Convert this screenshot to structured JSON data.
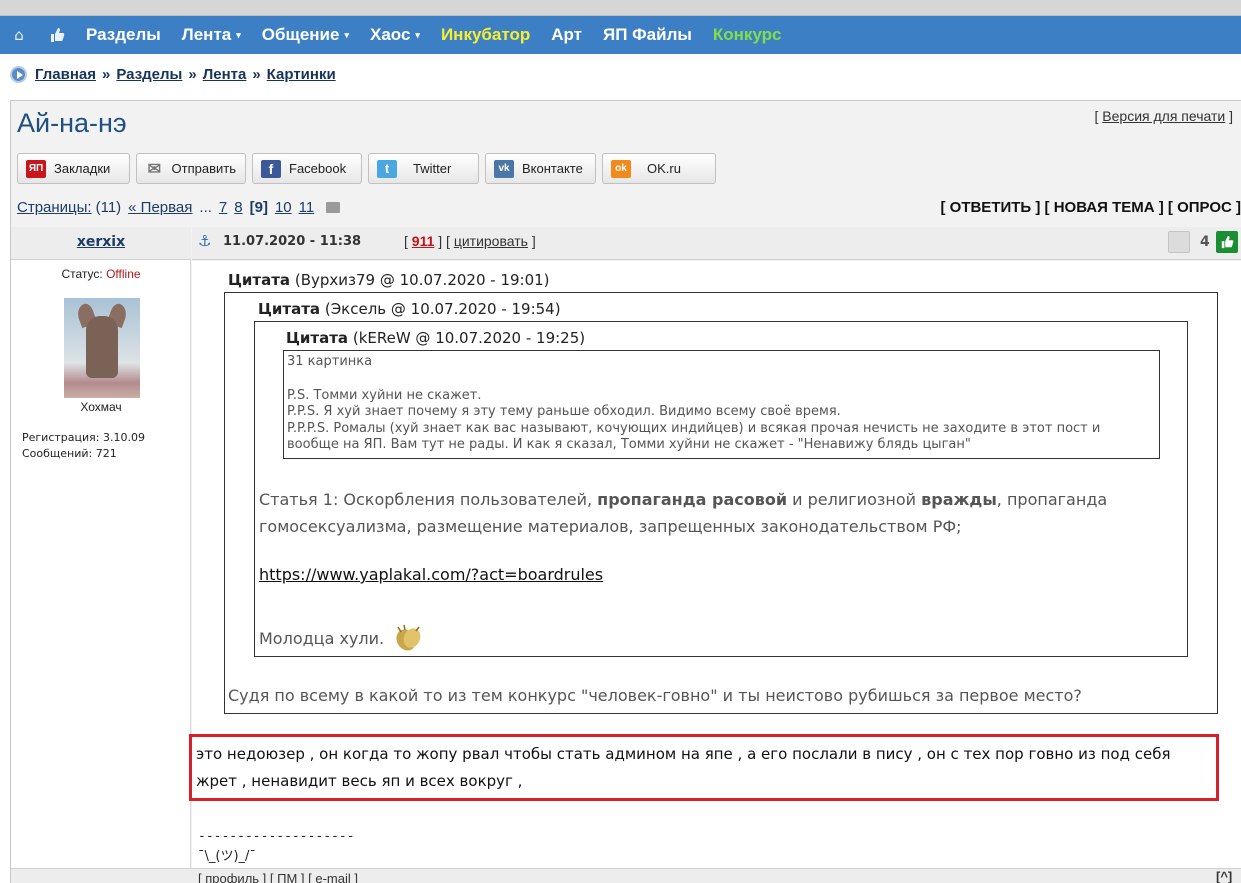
{
  "nav": {
    "items": [
      {
        "label": "Разделы",
        "dropdown": false,
        "color": "#ffffff"
      },
      {
        "label": "Лента",
        "dropdown": true,
        "color": "#ffffff"
      },
      {
        "label": "Общение",
        "dropdown": true,
        "color": "#ffffff"
      },
      {
        "label": "Хаос",
        "dropdown": true,
        "color": "#ffffff"
      },
      {
        "label": "Инкубатор",
        "dropdown": false,
        "color": "#f7ef2e"
      },
      {
        "label": "Арт",
        "dropdown": false,
        "color": "#ffffff"
      },
      {
        "label": "ЯП Файлы",
        "dropdown": false,
        "color": "#ffffff"
      },
      {
        "label": "Конкурс",
        "dropdown": false,
        "color": "#7fe04a"
      }
    ],
    "caret": "▾",
    "home_icon": "home-icon",
    "like_icon": "thumbs-up-icon",
    "bar_color": "#3d7fc4"
  },
  "breadcrumb": {
    "items": [
      "Главная",
      "Разделы",
      "Лента",
      "Картинки"
    ],
    "separator": "»"
  },
  "topic": {
    "title": "Ай-на-нэ",
    "print_version": "Версия для печати",
    "bracket_open": "[",
    "bracket_close": "]"
  },
  "share": {
    "buttons": [
      {
        "label": "Закладки",
        "icon": "yap-icon",
        "icon_text": "ЯП",
        "color": "#c8161d"
      },
      {
        "label": "Отправить",
        "icon": "mail-icon",
        "icon_text": "✉",
        "color": "#8a8a8a"
      },
      {
        "label": "Facebook",
        "icon": "facebook-icon",
        "icon_text": "f",
        "color": "#3b5998"
      },
      {
        "label": "Twitter",
        "icon": "twitter-icon",
        "icon_text": "t",
        "color": "#4aa7e0"
      },
      {
        "label": "Вконтакте",
        "icon": "vk-icon",
        "icon_text": "vk",
        "color": "#4a76a8"
      },
      {
        "label": "OK.ru",
        "icon": "ok-icon",
        "icon_text": "ok",
        "color": "#f08a1c"
      }
    ]
  },
  "pager": {
    "label": "Страницы:",
    "total": "(11)",
    "first": "« Первая",
    "ellipsis": "...",
    "pages": [
      "7",
      "8"
    ],
    "current": "[9]",
    "next_pages": [
      "10",
      "11"
    ]
  },
  "actions": {
    "reply": "[ ОТВЕТИТЬ ]",
    "new_topic": "[ НОВАЯ ТЕМА ]",
    "poll": "[ ОПРОС ]"
  },
  "author": {
    "name": "xerxix",
    "status_label": "Статус:",
    "status_value": "Offline",
    "rank": "Хохмач",
    "registration": "Регистрация: 3.10.09",
    "posts": "Сообщений: 721"
  },
  "post": {
    "anchor_icon": "anchor-icon",
    "date": "11.07.2020 - 11:38",
    "number": "911",
    "cite": "цитировать",
    "bracket_open": "[",
    "bracket_sep": "] [",
    "bracket_close": "]",
    "rating": "4",
    "rate_down_icon": "thumbs-down-icon",
    "rate_up_icon": "thumbs-up-icon"
  },
  "quotes": {
    "q1": {
      "label": "Цитата",
      "author": "(Вурхиз79 @ 10.07.2020 - 19:01)"
    },
    "q2": {
      "label": "Цитата",
      "author": "(Эксель @ 10.07.2020 - 19:54)"
    },
    "q3": {
      "label": "Цитата",
      "author": "(kEReW @ 10.07.2020 - 19:25)"
    },
    "q4_lines": [
      "31 картинка",
      "",
      "P.S. Томми хуйни не скажет.",
      "P.P.S. Я хуй знает почему я эту тему раньше обходил. Видимо всему своё время.",
      "P.P.P.S. Ромалы (хуй знает как вас называют, кочующих индийцев) и всякая прочая нечисть не заходите в этот пост и вообще на ЯП. Вам тут не рады. И как я сказал, Томми хуйни не скажет - \"Ненавижу блядь цыган\""
    ],
    "rules": {
      "p1": "Статья 1: Оскорбления пользователей, ",
      "b1": "пропаганда расовой",
      "p2": " и религиозной ",
      "b2": "вражды",
      "p3": ", пропаганда гомосексуализма, размещение материалов, запрещенных законодательством РФ;"
    },
    "rules_link": "https://www.yaplakal.com/?act=boardrules",
    "molodca": "Молодца хули.",
    "clap_icon": "clapping-hands-icon",
    "judging": "Судя по всему в какой то из тем конкурс \"человек-говно\" и ты неистово рубишься за первое место?"
  },
  "reply": {
    "text": "это недоюзер , он когда то жопу рвал чтобы стать админом на япе , а его послали в пису , он с тех пор говно из под себя жрет , ненавидит весь яп и всех вокруг ,",
    "highlight_color": "#d8202a"
  },
  "signature": {
    "line1": "--------------------",
    "line2": "¯\\_(ツ)_/¯"
  },
  "footer": {
    "profile": "профиль",
    "pm": "ПМ",
    "email": "e-mail",
    "to_top": "[^]"
  }
}
